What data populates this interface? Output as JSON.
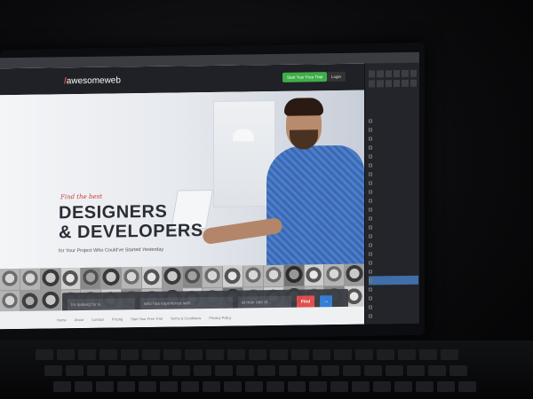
{
  "app": {
    "menu": [
      "",
      "",
      "",
      ""
    ]
  },
  "site": {
    "logo": "awesomeweb",
    "header_buttons": {
      "start": "Start Your Free Trial",
      "login": "Login"
    },
    "hero": {
      "tagline": "Find the best",
      "headline_1": "DESIGNERS",
      "headline_2": "& DEVELOPERS",
      "subheadline": "for Your Project Who Could've Started Yesterday"
    },
    "search": {
      "looking_for": "Im looking for a",
      "experience": "who has experience with...",
      "rate": "at max rate of...",
      "find_button": "Find",
      "more_button": "→"
    },
    "footer_links": [
      "Home",
      "About",
      "Contact",
      "Pricing",
      "Start Your Free Trial",
      "Terms & Conditions",
      "Privacy Policy"
    ]
  },
  "panel": {
    "layers": [
      "",
      "",
      "",
      "",
      "",
      "",
      "",
      "",
      "",
      "",
      "",
      "",
      "",
      "",
      "",
      "",
      "",
      "",
      "",
      "",
      "",
      "",
      ""
    ]
  }
}
